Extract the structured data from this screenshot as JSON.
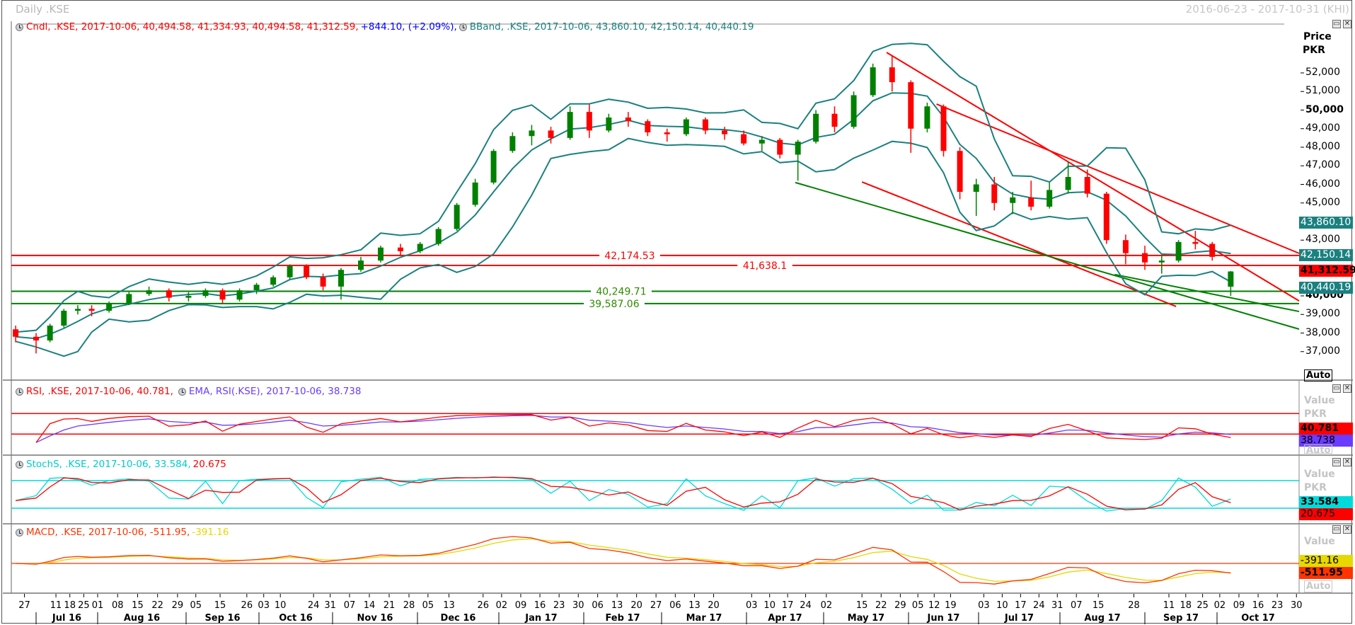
{
  "header": {
    "title": "Daily .KSE",
    "range": "2016-06-23 - 2017-10-31 (KHI)"
  },
  "legends": {
    "candle": {
      "text": "Cndl, .KSE, 2017-10-06, 40,494.58, 41,334.93, 40,494.58, 41,312.59,",
      "change": "+844.10, (+2.09%),"
    },
    "bband": "BBand, .KSE, 2017-10-06, 43,860.10, 42,150.14, 40,440.19",
    "rsi": "RSI, .KSE, 2017-10-06, 40.781,",
    "ema": "EMA, RSI(.KSE), 2017-10-06, 38.738",
    "stoch_k": "StochS, .KSE, 2017-10-06, 33.584,",
    "stoch_d": "20.675",
    "macd": "MACD, .KSE, 2017-10-06, -511.95,",
    "macd_signal": "-391.16"
  },
  "right_axis": {
    "price_title": "Price",
    "currency": "PKR",
    "value_title": "Value",
    "auto": "Auto",
    "price_ticks": [
      "52,000",
      "51,000",
      "50,000",
      "49,000",
      "48,000",
      "47,000",
      "46,000",
      "45,000",
      "43,000",
      "40,000",
      "39,000",
      "38,000",
      "37,000"
    ],
    "bold_ticks": [
      "50,000",
      "40,000"
    ],
    "boxes": {
      "bb_upper": "43,860.10",
      "bb_middle": "42,150.14",
      "last_close": "41,312.59",
      "bb_lower": "40,440.19",
      "rsi": "40.781",
      "rsi_ema": "38.738",
      "stoch_k": "33.584",
      "stoch_d": "20.675",
      "macd_signal": "-391.16",
      "macd": "-511.95"
    }
  },
  "colors": {
    "up": "#008000",
    "down": "#ff0000",
    "bband": "#1b8080",
    "rsi": "#ff0000",
    "rsi_ema": "#6a3cff",
    "stoch_k": "#00dada",
    "stoch_d": "#ff0000",
    "macd": "#ff3300",
    "macd_signal": "#e6d800",
    "support": "#008000",
    "resistance": "#ff0000"
  },
  "chart_data": {
    "type": "candlestick",
    "ylim": [
      36500,
      54000
    ],
    "x_range": [
      "2016-06-23",
      "2017-10-31"
    ],
    "ohlc_columns": [
      "date",
      "open",
      "high",
      "low",
      "close"
    ],
    "ohlc": [
      [
        "2016-06-24",
        38200,
        38400,
        37500,
        37800
      ],
      [
        "2016-07-01",
        37800,
        38000,
        36900,
        37600
      ],
      [
        "2016-07-08",
        37600,
        38500,
        37500,
        38400
      ],
      [
        "2016-07-15",
        38400,
        39300,
        38300,
        39200
      ],
      [
        "2016-07-22",
        39200,
        39500,
        39000,
        39300
      ],
      [
        "2016-07-29",
        39300,
        39500,
        38900,
        39200
      ],
      [
        "2016-08-05",
        39200,
        39700,
        39100,
        39600
      ],
      [
        "2016-08-12",
        39600,
        40200,
        39500,
        40100
      ],
      [
        "2016-08-19",
        40100,
        40500,
        40000,
        40300
      ],
      [
        "2016-08-26",
        40300,
        40400,
        39700,
        39900
      ],
      [
        "2016-09-02",
        39900,
        40200,
        39700,
        40000
      ],
      [
        "2016-09-09",
        40000,
        40400,
        39900,
        40300
      ],
      [
        "2016-09-16",
        40300,
        40400,
        39600,
        39800
      ],
      [
        "2016-09-23",
        39800,
        40400,
        39700,
        40300
      ],
      [
        "2016-09-30",
        40300,
        40700,
        40100,
        40600
      ],
      [
        "2016-10-07",
        40600,
        41100,
        40500,
        41000
      ],
      [
        "2016-10-14",
        41000,
        41700,
        40900,
        41600
      ],
      [
        "2016-10-21",
        41600,
        41700,
        40900,
        41000
      ],
      [
        "2016-10-28",
        41000,
        41200,
        40300,
        40500
      ],
      [
        "2016-11-04",
        40500,
        41500,
        39800,
        41400
      ],
      [
        "2016-11-11",
        41400,
        42100,
        41300,
        41900
      ],
      [
        "2016-11-18",
        41900,
        42700,
        41800,
        42600
      ],
      [
        "2016-11-25",
        42600,
        42800,
        42200,
        42400
      ],
      [
        "2016-12-02",
        42400,
        42900,
        42300,
        42800
      ],
      [
        "2016-12-09",
        42800,
        43700,
        42700,
        43600
      ],
      [
        "2016-12-16",
        43600,
        45000,
        43500,
        44900
      ],
      [
        "2016-12-23",
        44900,
        46300,
        44800,
        46100
      ],
      [
        "2016-12-30",
        46100,
        47900,
        46000,
        47800
      ],
      [
        "2017-01-06",
        47800,
        48800,
        47700,
        48600
      ],
      [
        "2017-01-13",
        48600,
        49200,
        48100,
        48900
      ],
      [
        "2017-01-20",
        48900,
        49100,
        48200,
        48500
      ],
      [
        "2017-01-27",
        48500,
        50200,
        48400,
        49900
      ],
      [
        "2017-02-03",
        49900,
        50300,
        48500,
        48900
      ],
      [
        "2017-02-10",
        48900,
        49800,
        48800,
        49600
      ],
      [
        "2017-02-17",
        49600,
        49900,
        49100,
        49400
      ],
      [
        "2017-02-24",
        49400,
        49500,
        48600,
        48800
      ],
      [
        "2017-03-03",
        48800,
        49000,
        48300,
        48700
      ],
      [
        "2017-03-10",
        48700,
        49600,
        48600,
        49500
      ],
      [
        "2017-03-17",
        49500,
        49600,
        48700,
        48900
      ],
      [
        "2017-03-24",
        48900,
        49100,
        48400,
        48700
      ],
      [
        "2017-03-31",
        48700,
        48900,
        48100,
        48200
      ],
      [
        "2017-04-07",
        48200,
        48600,
        47800,
        48400
      ],
      [
        "2017-04-14",
        48400,
        48500,
        47400,
        47600
      ],
      [
        "2017-04-21",
        47600,
        48400,
        46200,
        48300
      ],
      [
        "2017-04-28",
        48300,
        50000,
        48200,
        49800
      ],
      [
        "2017-05-05",
        49800,
        50200,
        48800,
        49100
      ],
      [
        "2017-05-12",
        49100,
        51000,
        49000,
        50800
      ],
      [
        "2017-05-19",
        50800,
        52500,
        50700,
        52300
      ],
      [
        "2017-05-26",
        52300,
        52900,
        51000,
        51500
      ],
      [
        "2017-06-02",
        51500,
        51600,
        47700,
        49000
      ],
      [
        "2017-06-09",
        49000,
        50400,
        48800,
        50200
      ],
      [
        "2017-06-16",
        50200,
        50300,
        47500,
        47800
      ],
      [
        "2017-06-23",
        47800,
        48000,
        45200,
        45600
      ],
      [
        "2017-06-30",
        45600,
        46300,
        44300,
        46000
      ],
      [
        "2017-07-07",
        46000,
        46400,
        44600,
        45000
      ],
      [
        "2017-07-14",
        45000,
        45600,
        44400,
        45300
      ],
      [
        "2017-07-21",
        45300,
        46200,
        44600,
        44800
      ],
      [
        "2017-07-28",
        44800,
        46100,
        44700,
        45700
      ],
      [
        "2017-08-04",
        45700,
        47200,
        45500,
        46400
      ],
      [
        "2017-08-11",
        46400,
        46800,
        45300,
        45500
      ],
      [
        "2017-08-18",
        45500,
        45600,
        42800,
        43000
      ],
      [
        "2017-08-25",
        43000,
        43300,
        41700,
        42300
      ],
      [
        "2017-09-01",
        42300,
        42700,
        41400,
        41800
      ],
      [
        "2017-09-08",
        41800,
        42200,
        41200,
        41900
      ],
      [
        "2017-09-15",
        41900,
        43000,
        41800,
        42900
      ],
      [
        "2017-09-22",
        42900,
        43500,
        42500,
        42800
      ],
      [
        "2017-09-29",
        42800,
        42900,
        41900,
        42100
      ],
      [
        "2017-10-06",
        40494.58,
        41334.93,
        40000,
        41312.59
      ]
    ],
    "horizontal_lines": [
      {
        "value": 42174.53,
        "label": "42,174.53",
        "type": "resistance"
      },
      {
        "value": 41638.1,
        "label": "41,638.1",
        "type": "resistance"
      },
      {
        "value": 40249.71,
        "label": "40,249.71",
        "type": "support"
      },
      {
        "value": 39587.06,
        "label": "39,587.06",
        "type": "support"
      }
    ],
    "trend_lines": [
      {
        "type": "resistance",
        "from": [
          "2017-05-24",
          53100
        ],
        "to": [
          "2017-10-31",
          39730
        ]
      },
      {
        "type": "resistance",
        "from": [
          "2017-06-13",
          50320
        ],
        "to": [
          "2017-10-31",
          42290
        ]
      },
      {
        "type": "resistance",
        "from": [
          "2017-05-15",
          46130
        ],
        "to": [
          "2017-09-14",
          39430
        ]
      },
      {
        "type": "support",
        "from": [
          "2017-04-20",
          46100
        ],
        "to": [
          "2017-10-31",
          38210
        ]
      },
      {
        "type": "support",
        "from": [
          "2017-08-21",
          41150
        ],
        "to": [
          "2017-10-31",
          39160
        ]
      }
    ],
    "indicators": {
      "bband": "BBand",
      "rsi": {
        "levels": [
          70,
          30
        ]
      },
      "stoch": {
        "levels": [
          80,
          20
        ]
      },
      "macd": {
        "zero_line": true
      }
    },
    "x_day_ticks": [
      [
        "27",
        "2016-06-27"
      ],
      [
        "11",
        "2016-07-11"
      ],
      [
        "18",
        "2016-07-18"
      ],
      [
        "25",
        "2016-07-25"
      ],
      [
        "01",
        "2016-08-01"
      ],
      [
        "08",
        "2016-08-08"
      ],
      [
        "15",
        "2016-08-15"
      ],
      [
        "22",
        "2016-08-22"
      ],
      [
        "29",
        "2016-08-29"
      ],
      [
        "05",
        "2016-09-05"
      ],
      [
        "15",
        "2016-09-15"
      ],
      [
        "26",
        "2016-09-26"
      ],
      [
        "03",
        "2016-10-03"
      ],
      [
        "10",
        "2016-10-10"
      ],
      [
        "24",
        "2016-10-24"
      ],
      [
        "31",
        "2016-10-31"
      ],
      [
        "07",
        "2016-11-07"
      ],
      [
        "14",
        "2016-11-14"
      ],
      [
        "21",
        "2016-11-21"
      ],
      [
        "28",
        "2016-11-28"
      ],
      [
        "05",
        "2016-12-05"
      ],
      [
        "13",
        "2016-12-13"
      ],
      [
        "26",
        "2016-12-26"
      ],
      [
        "02",
        "2017-01-02"
      ],
      [
        "09",
        "2017-01-09"
      ],
      [
        "16",
        "2017-01-16"
      ],
      [
        "23",
        "2017-01-23"
      ],
      [
        "30",
        "2017-01-30"
      ],
      [
        "06",
        "2017-02-06"
      ],
      [
        "13",
        "2017-02-13"
      ],
      [
        "20",
        "2017-02-20"
      ],
      [
        "27",
        "2017-02-27"
      ],
      [
        "06",
        "2017-03-06"
      ],
      [
        "13",
        "2017-03-13"
      ],
      [
        "20",
        "2017-03-20"
      ],
      [
        "03",
        "2017-04-03"
      ],
      [
        "10",
        "2017-04-10"
      ],
      [
        "17",
        "2017-04-17"
      ],
      [
        "24",
        "2017-04-24"
      ],
      [
        "02",
        "2017-05-02"
      ],
      [
        "15",
        "2017-05-15"
      ],
      [
        "22",
        "2017-05-22"
      ],
      [
        "29",
        "2017-05-29"
      ],
      [
        "05",
        "2017-06-05"
      ],
      [
        "12",
        "2017-06-12"
      ],
      [
        "19",
        "2017-06-19"
      ],
      [
        "03",
        "2017-07-03"
      ],
      [
        "10",
        "2017-07-10"
      ],
      [
        "17",
        "2017-07-17"
      ],
      [
        "24",
        "2017-07-24"
      ],
      [
        "31",
        "2017-07-31"
      ],
      [
        "07",
        "2017-08-07"
      ],
      [
        "15",
        "2017-08-15"
      ],
      [
        "28",
        "2017-08-28"
      ],
      [
        "11",
        "2017-09-11"
      ],
      [
        "18",
        "2017-09-18"
      ],
      [
        "25",
        "2017-09-25"
      ],
      [
        "02",
        "2017-10-02"
      ],
      [
        "09",
        "2017-10-09"
      ],
      [
        "16",
        "2017-10-16"
      ],
      [
        "23",
        "2017-10-23"
      ],
      [
        "30",
        "2017-10-30"
      ]
    ],
    "x_month_labels": [
      [
        "Jul 16",
        "2016-07"
      ],
      [
        "Aug 16",
        "2016-08"
      ],
      [
        "Sep 16",
        "2016-09"
      ],
      [
        "Oct 16",
        "2016-10"
      ],
      [
        "Nov 16",
        "2016-11"
      ],
      [
        "Dec 16",
        "2016-12"
      ],
      [
        "Jan 17",
        "2017-01"
      ],
      [
        "Feb 17",
        "2017-02"
      ],
      [
        "Mar 17",
        "2017-03"
      ],
      [
        "Apr 17",
        "2017-04"
      ],
      [
        "May 17",
        "2017-05"
      ],
      [
        "Jun 17",
        "2017-06"
      ],
      [
        "Jul 17",
        "2017-07"
      ],
      [
        "Aug 17",
        "2017-08"
      ],
      [
        "Sep 17",
        "2017-09"
      ],
      [
        "Oct 17",
        "2017-10"
      ]
    ]
  }
}
